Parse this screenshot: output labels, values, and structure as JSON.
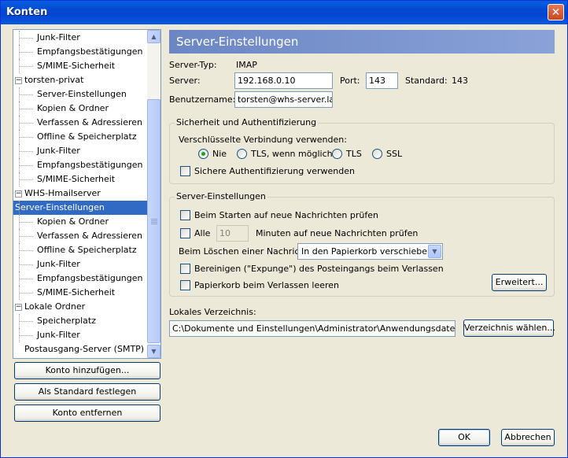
{
  "window": {
    "title": "Konten",
    "close_glyph": "✕"
  },
  "tree": {
    "items": [
      {
        "label": "Junk-Filter",
        "level": 1
      },
      {
        "label": "Empfangsbestätigungen",
        "level": 1
      },
      {
        "label": "S/MIME-Sicherheit",
        "level": 1
      },
      {
        "label": "torsten-privat",
        "level": 0,
        "expanded": true
      },
      {
        "label": "Server-Einstellungen",
        "level": 1
      },
      {
        "label": "Kopien & Ordner",
        "level": 1
      },
      {
        "label": "Verfassen & Adressieren",
        "level": 1
      },
      {
        "label": "Offline & Speicherplatz",
        "level": 1
      },
      {
        "label": "Junk-Filter",
        "level": 1
      },
      {
        "label": "Empfangsbestätigungen",
        "level": 1
      },
      {
        "label": "S/MIME-Sicherheit",
        "level": 1
      },
      {
        "label": "WHS-Hmailserver",
        "level": 0,
        "expanded": true
      },
      {
        "label": "Server-Einstellungen",
        "level": 1,
        "selected": true
      },
      {
        "label": "Kopien & Ordner",
        "level": 1
      },
      {
        "label": "Verfassen & Adressieren",
        "level": 1
      },
      {
        "label": "Offline & Speicherplatz",
        "level": 1
      },
      {
        "label": "Junk-Filter",
        "level": 1
      },
      {
        "label": "Empfangsbestätigungen",
        "level": 1
      },
      {
        "label": "S/MIME-Sicherheit",
        "level": 1
      },
      {
        "label": "Lokale Ordner",
        "level": 0,
        "expanded": true
      },
      {
        "label": "Speicherplatz",
        "level": 1
      },
      {
        "label": "Junk-Filter",
        "level": 1
      },
      {
        "label": "Postausgang-Server (SMTP)",
        "level": 0
      }
    ],
    "expander_glyph": "−"
  },
  "left_buttons": {
    "add_account": "Konto hinzufügen...",
    "set_default": "Als Standard festlegen",
    "remove_account": "Konto entfernen"
  },
  "panel": {
    "title": "Server-Einstellungen",
    "server_type_label": "Server-Typ:",
    "server_type_value": "IMAP",
    "server_label": "Server:",
    "server_value": "192.168.0.10",
    "port_label": "Port:",
    "port_value": "143",
    "standard_label": "Standard:",
    "standard_value": "143",
    "username_label": "Benutzername:",
    "username_value": "torsten@whs-server.lan",
    "security": {
      "title": "Sicherheit und Authentifizierung",
      "encryption_label": "Verschlüsselte Verbindung verwenden:",
      "options": [
        "Nie",
        "TLS, wenn möglich",
        "TLS",
        "SSL"
      ],
      "selected": "Nie",
      "secure_auth_label": "Sichere Authentifizierung verwenden",
      "secure_auth_checked": false
    },
    "server_settings": {
      "title": "Server-Einstellungen",
      "check_on_start": "Beim Starten auf neue Nachrichten prüfen",
      "every_label": "Alle",
      "minutes_value": "10",
      "minutes_label": "Minuten auf neue Nachrichten prüfen",
      "on_delete_label": "Beim Löschen einer Nachricht:",
      "on_delete_value": "In den Papierkorb verschieben",
      "expunge_label": "Bereinigen (\"Expunge\") des Posteingangs beim Verlassen",
      "empty_trash_label": "Papierkorb beim Verlassen leeren",
      "advanced_button": "Erweitert..."
    },
    "local_dir_label": "Lokales Verzeichnis:",
    "local_dir_value": "C:\\Dokumente und Einstellungen\\Administrator\\Anwendungsdaten\\Thunde",
    "choose_dir_button": "Verzeichnis wählen..."
  },
  "dialog_buttons": {
    "ok": "OK",
    "cancel": "Abbrechen"
  },
  "icons": {
    "scroll_up": "▲",
    "scroll_down": "▼",
    "dropdown": "▼"
  }
}
